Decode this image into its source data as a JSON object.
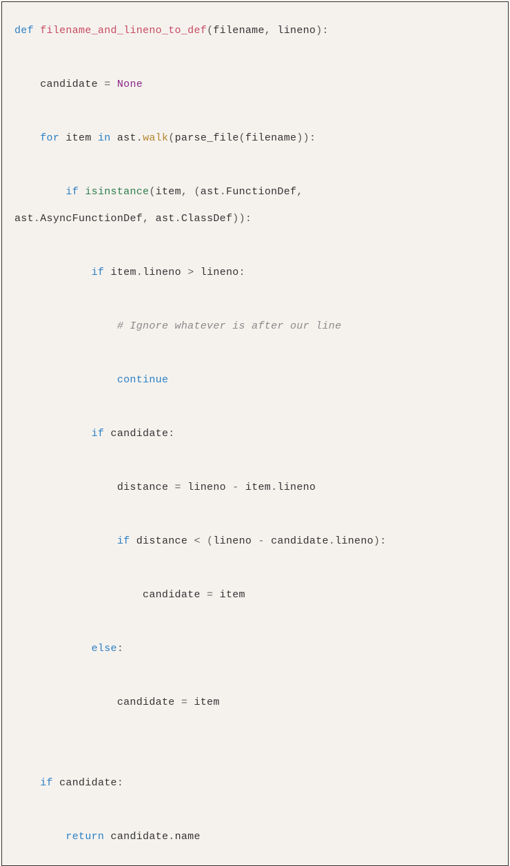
{
  "code": {
    "line1": {
      "kw_def": "def",
      "fn_name": "filename_and_lineno_to_def",
      "paren_open": "(",
      "param1": "filename",
      "comma1": ",",
      "param2": " lineno",
      "paren_close": "):"
    },
    "line2": {
      "indent": "    ",
      "ident": "candidate ",
      "op": "= ",
      "none": "None"
    },
    "line3": {
      "indent": "    ",
      "kw_for": "for",
      "item": " item ",
      "kw_in": "in",
      "walk1": " ast",
      "dot1": ".",
      "walk2": "walk",
      "paren_open": "(",
      "parse": "parse_file",
      "paren_open2": "(",
      "fname": "filename",
      "close": ")):"
    },
    "line4": {
      "indent": "        ",
      "kw_if": "if",
      "sp": " ",
      "isinstance": "isinstance",
      "paren_open": "(",
      "item": "item",
      "comma": ", (",
      "ast1": "ast",
      "dot1": ".",
      "fd": "FunctionDef",
      "comma2": ","
    },
    "line5": {
      "ast2": "ast",
      "dot2": ".",
      "afd": "AsyncFunctionDef",
      "comma3": ", ",
      "ast3": "ast",
      "dot3": ".",
      "cd": "ClassDef",
      "close": ")):"
    },
    "line6": {
      "indent": "            ",
      "kw_if": "if",
      "sp": " item",
      "dot": ".",
      "lineno": "lineno ",
      "gt": "> ",
      "lineno2": "lineno",
      "colon": ":"
    },
    "line7": {
      "indent": "                ",
      "comment": "# Ignore whatever is after our line"
    },
    "line8": {
      "indent": "                ",
      "kw": "continue"
    },
    "line9": {
      "indent": "            ",
      "kw_if": "if",
      "cand": " candidate",
      "colon": ":"
    },
    "line10": {
      "indent": "                ",
      "dist": "distance ",
      "op": "= ",
      "expr1": "lineno ",
      "minus": "- ",
      "expr2": "item",
      "dot": ".",
      "lineno": "lineno"
    },
    "line11": {
      "indent": "                ",
      "kw_if": "if",
      "sp": " distance ",
      "lt": "< (",
      "expr1": "lineno ",
      "minus": "- ",
      "expr2": "candidate",
      "dot": ".",
      "lineno": "lineno",
      "close": "):"
    },
    "line12": {
      "indent": "                    ",
      "cand": "candidate ",
      "op": "= ",
      "item": "item"
    },
    "line13": {
      "indent": "            ",
      "kw": "else",
      "colon": ":"
    },
    "line14": {
      "indent": "                ",
      "cand": "candidate ",
      "op": "= ",
      "item": "item"
    },
    "line15": {
      "indent": "    ",
      "kw_if": "if",
      "cand": " candidate",
      "colon": ":"
    },
    "line16": {
      "indent": "        ",
      "kw": "return",
      "sp": " candidate",
      "dot": ".",
      "name": "name"
    }
  }
}
